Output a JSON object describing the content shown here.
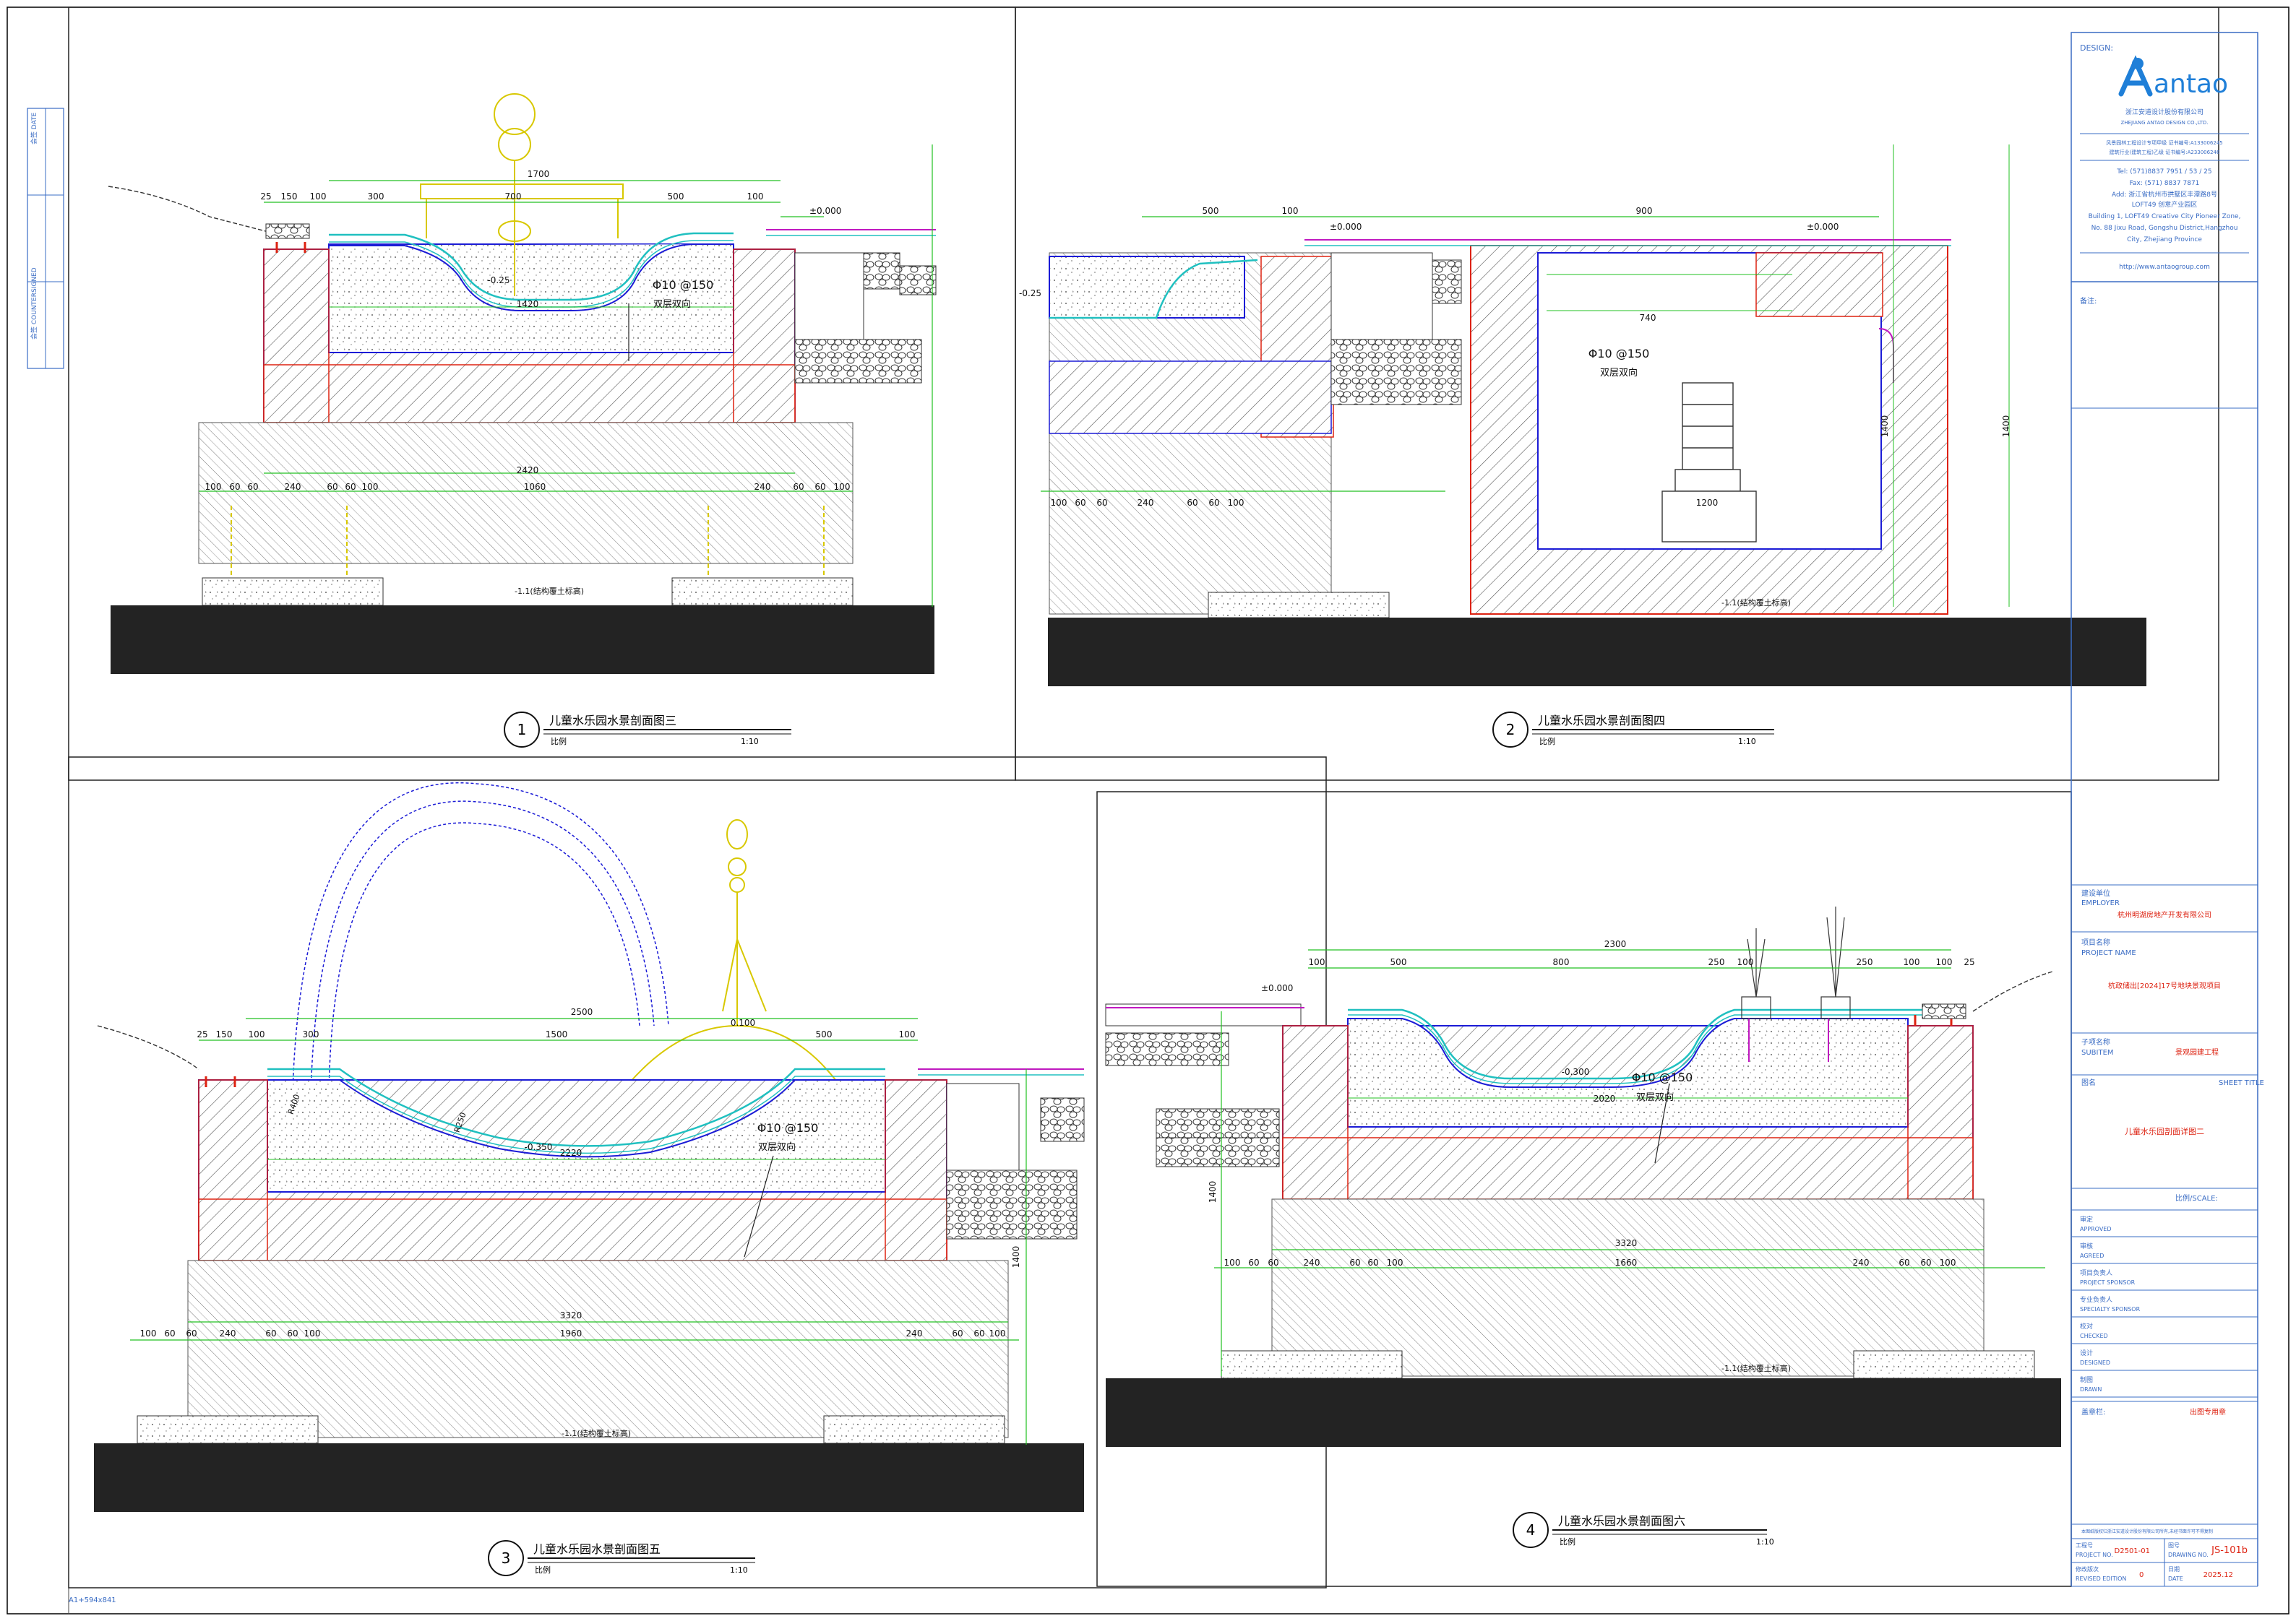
{
  "title_block": {
    "design_label": "DESIGN:",
    "logo_text": "antao",
    "company_cn": "浙江安道设计股份有限公司",
    "company_en": "ZHEJIANG ANTAO DESIGN CO.,LTD.",
    "cert_line1": "风景园林工程设计专项甲级 证书编号:A133006245",
    "cert_line2": "建筑行业(建筑工程)乙级 证书编号:A233006246",
    "tel": "Tel: (571)8837 7951 / 53 / 25",
    "fax": "Fax: (571) 8837 7871",
    "addr1": "Add: 浙江省杭州市拱墅区丰潭路8号",
    "addr2": "LOFT49 创意产业园区",
    "addr3": "Building 1, LOFT49 Creative City Pioneer Zone,",
    "addr4": "No. 88 Jixu Road, Gongshu District,Hangzhou",
    "addr5": "City, Zhejiang Province",
    "website": "http://www.antaogroup.com",
    "notes_label": "备注:",
    "employer_cn": "建设单位",
    "employer_en": "EMPLOYER",
    "employer_value": "杭州明湖房地产开发有限公司",
    "project_cn": "项目名称",
    "project_en": "PROJECT NAME",
    "project_value": "杭政储出[2024]17号地块景观项目",
    "subitem_cn": "子项名称",
    "subitem_en": "SUBITEM",
    "subitem_value": "景观园建工程",
    "sheet_title_cn": "图名",
    "sheet_title_en": "SHEET TITLE",
    "sheet_title_value": "儿童水乐园剖面详图二",
    "scale_label": "比例/SCALE:",
    "signoffs": [
      {
        "cn": "审定",
        "en": "APPROVED"
      },
      {
        "cn": "审核",
        "en": "AGREED"
      },
      {
        "cn": "项目负责人",
        "en": "PROJECT SPONSOR"
      },
      {
        "cn": "专业负责人",
        "en": "SPECIALTY SPONSOR"
      },
      {
        "cn": "校对",
        "en": "CHECKED"
      },
      {
        "cn": "设计",
        "en": "DESIGNED"
      },
      {
        "cn": "制图",
        "en": "DRAWN"
      }
    ],
    "seal_label": "盖章栏:",
    "seal_value": "出图专用章",
    "disclaimer": "本图纸版权归浙江安道设计股份有限公司所有,未经书面许可不得复制",
    "project_no_cn": "工程号",
    "project_no_en": "PROJECT NO.",
    "project_no": "D2501-01",
    "drawing_no_cn": "图号",
    "drawing_no_en": "DRAWING NO.",
    "drawing_no": "JS-101b",
    "revised_cn": "修改版次",
    "revised_en": "REVISED EDITION",
    "revised": "0",
    "date_cn": "日期",
    "date_en": "DATE",
    "date": "2025.12"
  },
  "left_strip": {
    "top_label": "会签 DATE",
    "mid_label": "会签 COUNTERSIGNED"
  },
  "sheet_size_note": "A1+594x841",
  "sections": [
    {
      "number": "1",
      "title": "儿童水乐园水景剖面图三",
      "scale_label": "比例",
      "scale": "1:10",
      "top_dims": [
        "25",
        "150",
        "100",
        "300",
        "700",
        "500",
        "100"
      ],
      "upper_dim": "1700",
      "level_top": "±0.000",
      "level_bottom": "-0.25",
      "rebar": "Φ10 @150",
      "rebar_note": "双层双向",
      "base_dims": [
        "100",
        "60",
        "60",
        "240",
        "60",
        "60",
        "100",
        "1060",
        "240",
        "60",
        "60",
        "100"
      ],
      "overall_dim": "2420",
      "inner_dim": "1420",
      "found_note": "-1.1(结构覆土标高)"
    },
    {
      "number": "2",
      "title": "儿童水乐园水景剖面图四",
      "scale_label": "比例",
      "scale": "1:10",
      "top_dims": [
        "500",
        "100",
        "900"
      ],
      "level_a": "±0.000",
      "level_b": "±0.000",
      "level_c": "-0.25",
      "pit_width": "740",
      "pump_width": "1200",
      "pit_height": "1400",
      "rebar": "Φ10 @150",
      "rebar_note": "双层双向",
      "base_dims": [
        "100",
        "60",
        "60",
        "240",
        "60",
        "60",
        "100"
      ],
      "found_note": "-1.1(结构覆土标高)"
    },
    {
      "number": "3",
      "title": "儿童水乐园水景剖面图五",
      "scale_label": "比例",
      "scale": "1:10",
      "top_dims": [
        "25",
        "150",
        "100",
        "300",
        "1500",
        "500",
        "100"
      ],
      "upper_dim": "2500",
      "level_top": "0.100",
      "level_bottom": "-0.350",
      "inner_dim": "2220",
      "rebar": "Φ10 @150",
      "rebar_note": "双层双向",
      "radius_a": "R400",
      "radius_b": "R250",
      "overall_dim": "3320",
      "base_mid": "1960",
      "base_dims": [
        "100",
        "60",
        "60",
        "240",
        "60",
        "60",
        "100",
        "240",
        "60",
        "60",
        "100"
      ],
      "side_height": "1400",
      "found_note": "-1.1(结构覆土标高)"
    },
    {
      "number": "4",
      "title": "儿童水乐园水景剖面图六",
      "scale_label": "比例",
      "scale": "1:10",
      "top_dims": [
        "100",
        "500",
        "800",
        "250",
        "100",
        "250",
        "100",
        "100",
        "25"
      ],
      "upper_dim": "2300",
      "level_top": "±0.000",
      "level_bottom": "-0.300",
      "inner_dim": "2020",
      "rebar": "Φ10 @150",
      "rebar_note": "双层双向",
      "overall_dim": "3320",
      "base_mid": "1660",
      "base_dims": [
        "100",
        "60",
        "60",
        "240",
        "60",
        "60",
        "100",
        "240",
        "60",
        "60",
        "100"
      ],
      "side_height": "1400",
      "found_note": "-1.1(结构覆土标高)"
    }
  ]
}
